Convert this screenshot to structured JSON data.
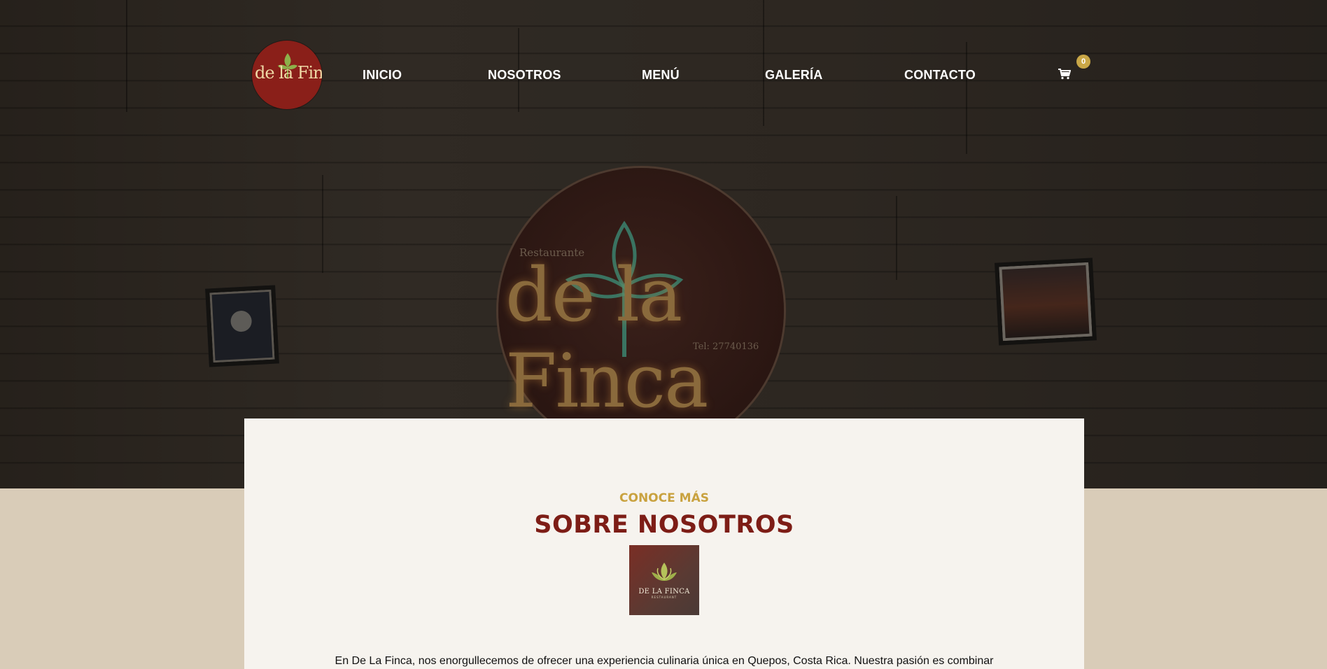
{
  "brand": {
    "logo_text": "de la Finca"
  },
  "nav": {
    "items": [
      {
        "label": "INICIO"
      },
      {
        "label": "NOSOTROS"
      },
      {
        "label": "MENÚ"
      },
      {
        "label": "GALERÍA"
      },
      {
        "label": "CONTACTO"
      }
    ],
    "cart_count": "0",
    "cart_icon": "shopping-cart-icon"
  },
  "hero": {
    "sign_small": "Restaurante",
    "sign_main": "de la Finca",
    "sign_tel": "Tel: 27740136"
  },
  "about": {
    "eyebrow": "CONOCE MÁS",
    "title": "SOBRE NOSOTROS",
    "badge_title": "DE LA FINCA",
    "badge_sub": "RESTAURANT",
    "paragraph": "En De La Finca, nos enorgullecemos de ofrecer una experiencia culinaria única en Quepos, Costa Rica. Nuestra pasión es combinar"
  },
  "colors": {
    "brand_red": "#7d1d16",
    "gold": "#c9a23f",
    "page_bg": "#d9ccb8",
    "card_bg": "#f6f3ee"
  }
}
